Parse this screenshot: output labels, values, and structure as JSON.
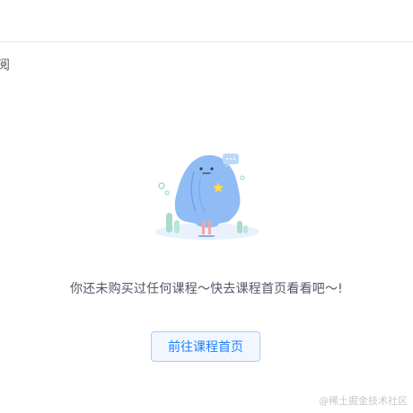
{
  "header": {
    "tab_partial": "阅"
  },
  "empty_state": {
    "message": "你还未购买过任何课程～快去课程首页看看吧～!",
    "button_label": "前往课程首页",
    "illustration_icon": "ghost-mascot-icon"
  },
  "watermark": "@稀土掘金技术社区",
  "colors": {
    "accent": "#1e80ff",
    "button_bg": "#f2f7ff",
    "button_border": "#abcdff",
    "text": "#515767",
    "mascot": "#8fbcf5"
  }
}
